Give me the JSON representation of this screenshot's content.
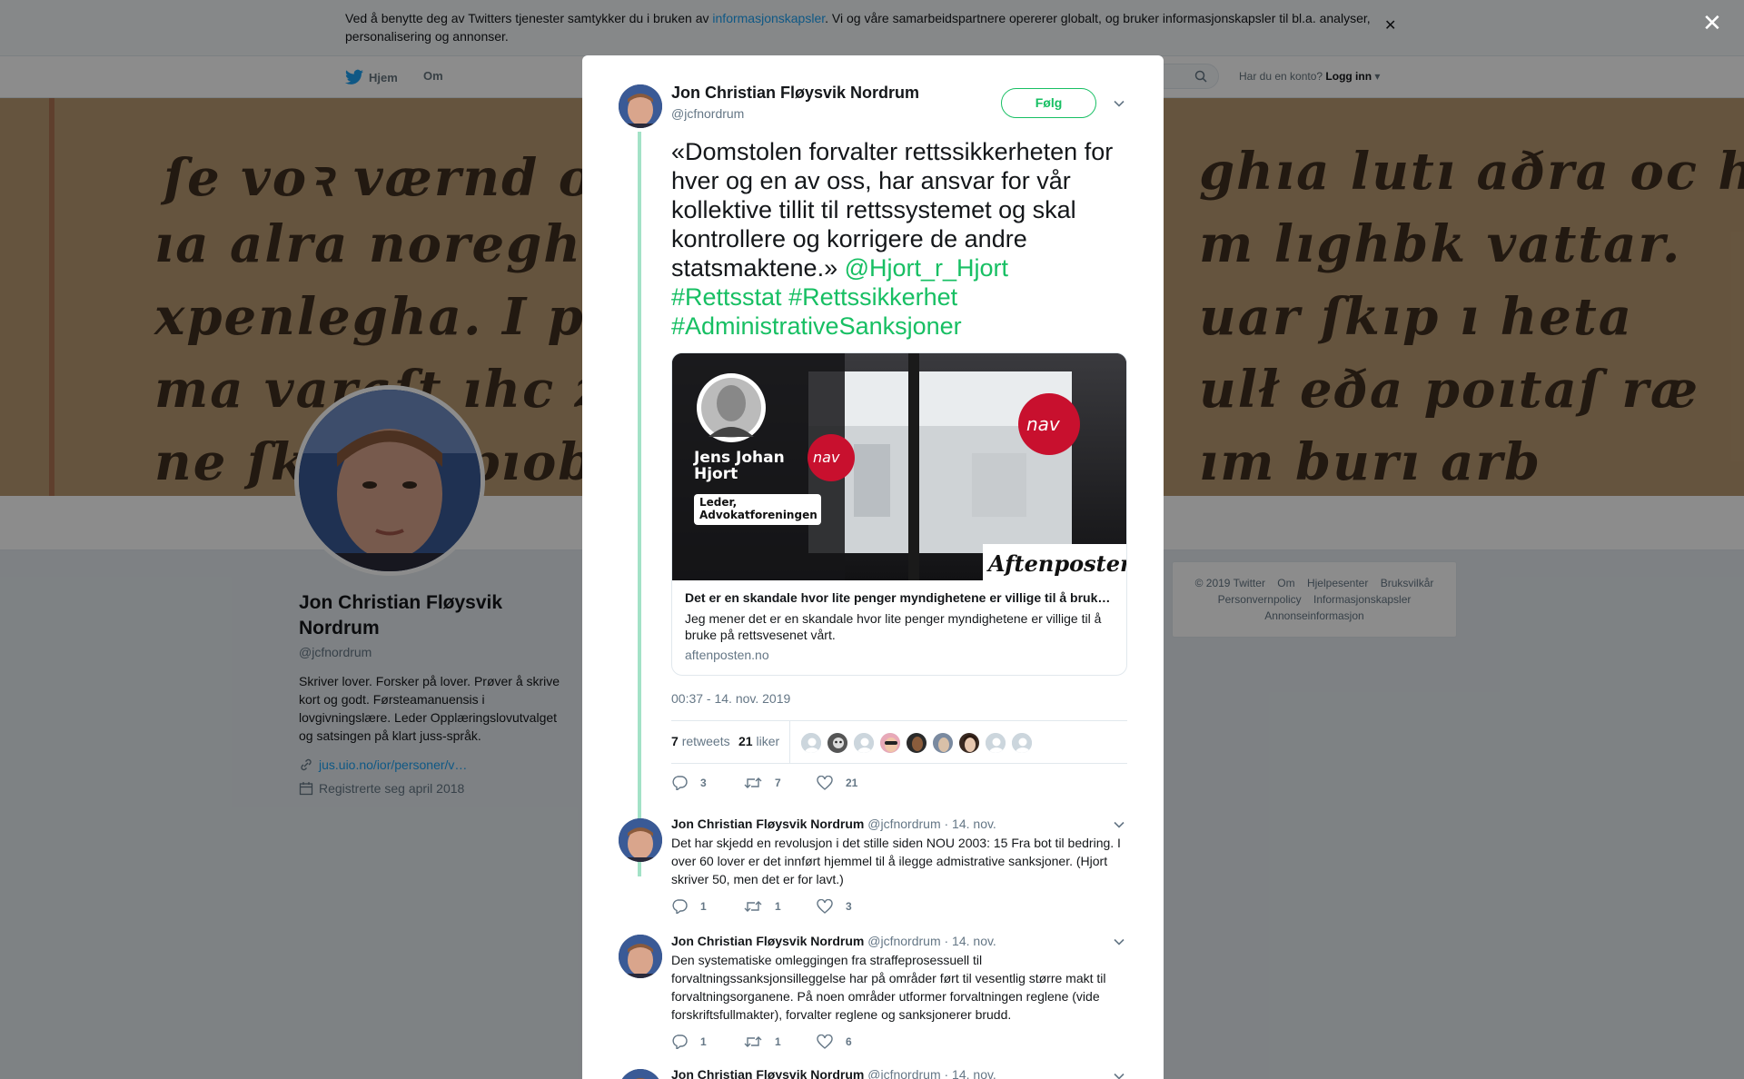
{
  "cookie": {
    "text_before": "Ved å benytte deg av Twitters tjenester samtykker du i bruken av ",
    "link": "informasjonskapsler",
    "text_after": ". Vi og våre samarbeidspartnere opererer globalt, og bruker informasjonskapsler til bl.a. analyser, personalisering og annonser."
  },
  "nav": {
    "home": "Hjem",
    "about": "Om",
    "account_prompt": "Har du en konto?",
    "login": "Logg inn"
  },
  "banner": {
    "lines": [
      "ſe voꝛ værnd ᴏc va",
      "ıa alra noreghs m",
      "xpenlegha. I pe",
      "ma varaſt ıhc z",
      "ne ſkal b ſpıoble"
    ],
    "lines_right": [
      "ghıa lutı aðra ᴏc hỏ",
      "m lıghbk vattar.",
      "uar ſkıp ı heta",
      "ulł eða poıtaſ ræ",
      "ım burı arb"
    ]
  },
  "profile": {
    "name": "Jon Christian Fløysvik Nordrum",
    "handle": "@jcfnordrum",
    "bio": "Skriver lover. Forsker på lover. Prøver å skrive kort og godt. Førsteamanuensis i lovgivningslære. Leder Opplæringslovutvalget og satsingen på klart juss-språk.",
    "link": "jus.uio.no/ior/personer/v…",
    "joined": "Registrerte seg april 2018"
  },
  "footer": {
    "items": [
      "© 2019 Twitter",
      "Om",
      "Hjelpesenter",
      "Bruksvilkår",
      "Personvernpolicy",
      "Informasjonskapsler",
      "Annonseinformasjon"
    ]
  },
  "main_tweet": {
    "name": "Jon Christian Fløysvik Nordrum",
    "handle": "@jcfnordrum",
    "follow": "Følg",
    "text": "«Domstolen forvalter rettssikkerheten for hver og en av oss, har ansvar for vår kollektive tillit til rettssystemet og skal kontrollere og korrigere de andre statsmaktene.» ",
    "mention": "@Hjort_r_Hjort",
    "hashtags": [
      "#Rettsstat",
      "#Rettssikkerhet",
      "#AdministrativeSanksjoner"
    ],
    "card": {
      "person_name": "Jens Johan Hjort",
      "person_role": "Leder, Advokatforeningen",
      "logo": "Aftenposten",
      "brand": "nav",
      "title": "Det er en skandale hvor lite penger myndighetene er villige til å bruke på rettsvesenet vårt.",
      "description": "Jeg mener det er en skandale hvor lite penger myndighetene er villige til å bruke på rettsvesenet vårt.",
      "domain": "aftenposten.no"
    },
    "time": "00:37 - 14. nov. 2019",
    "retweets_count": "7",
    "retweets_label": "retweets",
    "likes_count": "21",
    "likes_label": "liker",
    "actions": {
      "replies": "3",
      "retweets": "7",
      "likes": "21"
    }
  },
  "replies": [
    {
      "name": "Jon Christian Fløysvik Nordrum",
      "handle": "@jcfnordrum",
      "date": "· 14. nov.",
      "text": "Det har skjedd en revolusjon i det stille siden NOU 2003: 15 Fra bot til bedring. I over 60 lover er det innført hjemmel til å ilegge admistrative sanksjoner. (Hjort skriver 50, men det er for lavt.)",
      "replies": "1",
      "retweets": "1",
      "likes": "3"
    },
    {
      "name": "Jon Christian Fløysvik Nordrum",
      "handle": "@jcfnordrum",
      "date": "· 14. nov.",
      "text": "Den systematiske omleggingen fra straffeprosessuell til forvaltningssanksjonsilleggelse har på områder ført til vesentlig større makt til forvaltningsorganene. På noen områder utformer forvaltningen reglene (vide forskriftsfullmakter), forvalter reglene og sanksjonerer brudd.",
      "replies": "1",
      "retweets": "1",
      "likes": "6"
    },
    {
      "name": "Jon Christian Fløysvik Nordrum",
      "handle": "@jcfnordrum",
      "date": "· 14. nov."
    }
  ],
  "colors": {
    "accent": "#17bf63",
    "thread": "#a3e2c7",
    "twitter_blue": "#1da1f2"
  }
}
